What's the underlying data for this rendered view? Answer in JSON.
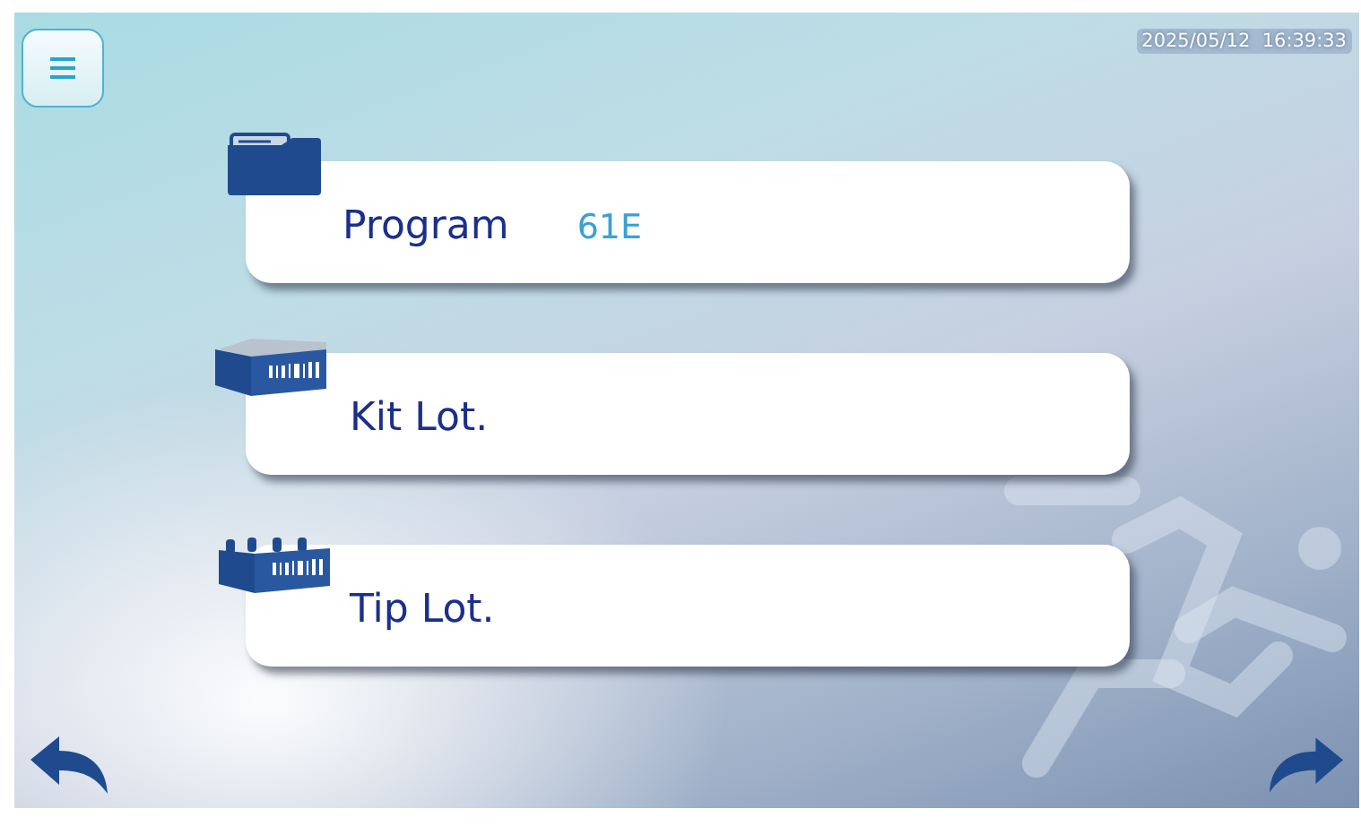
{
  "header": {
    "timestamp": "2025/05/12  16:39:33"
  },
  "fields": [
    {
      "kind": "program",
      "label": "Program",
      "value": "61E"
    },
    {
      "kind": "kit",
      "label": "Kit Lot."
    },
    {
      "kind": "tip",
      "label": "Tip Lot."
    }
  ]
}
